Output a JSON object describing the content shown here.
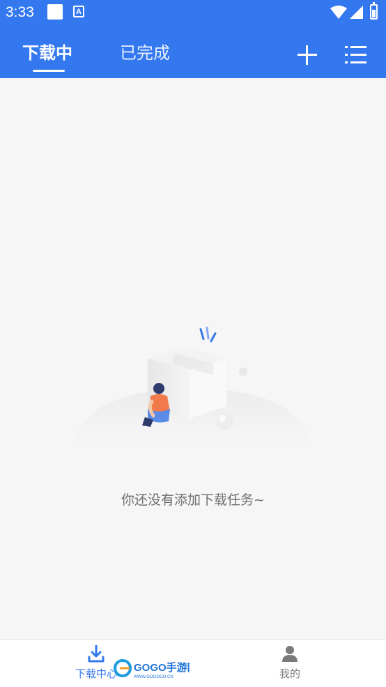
{
  "status_bar": {
    "time": "3:33",
    "notification_letter": "A"
  },
  "header": {
    "tabs": [
      {
        "label": "下载中",
        "active": true
      },
      {
        "label": "已完成",
        "active": false
      }
    ],
    "accent_color": "#3478f0"
  },
  "empty_state": {
    "message": "你还没有添加下载任务~"
  },
  "bottom_nav": {
    "items": [
      {
        "label": "下载中心",
        "icon": "download-icon",
        "active": true
      },
      {
        "label": "我的",
        "icon": "person-icon",
        "active": false
      }
    ]
  },
  "watermark": {
    "brand": "GOGO手游网",
    "url": "WWW.GOGOGO.CN"
  }
}
